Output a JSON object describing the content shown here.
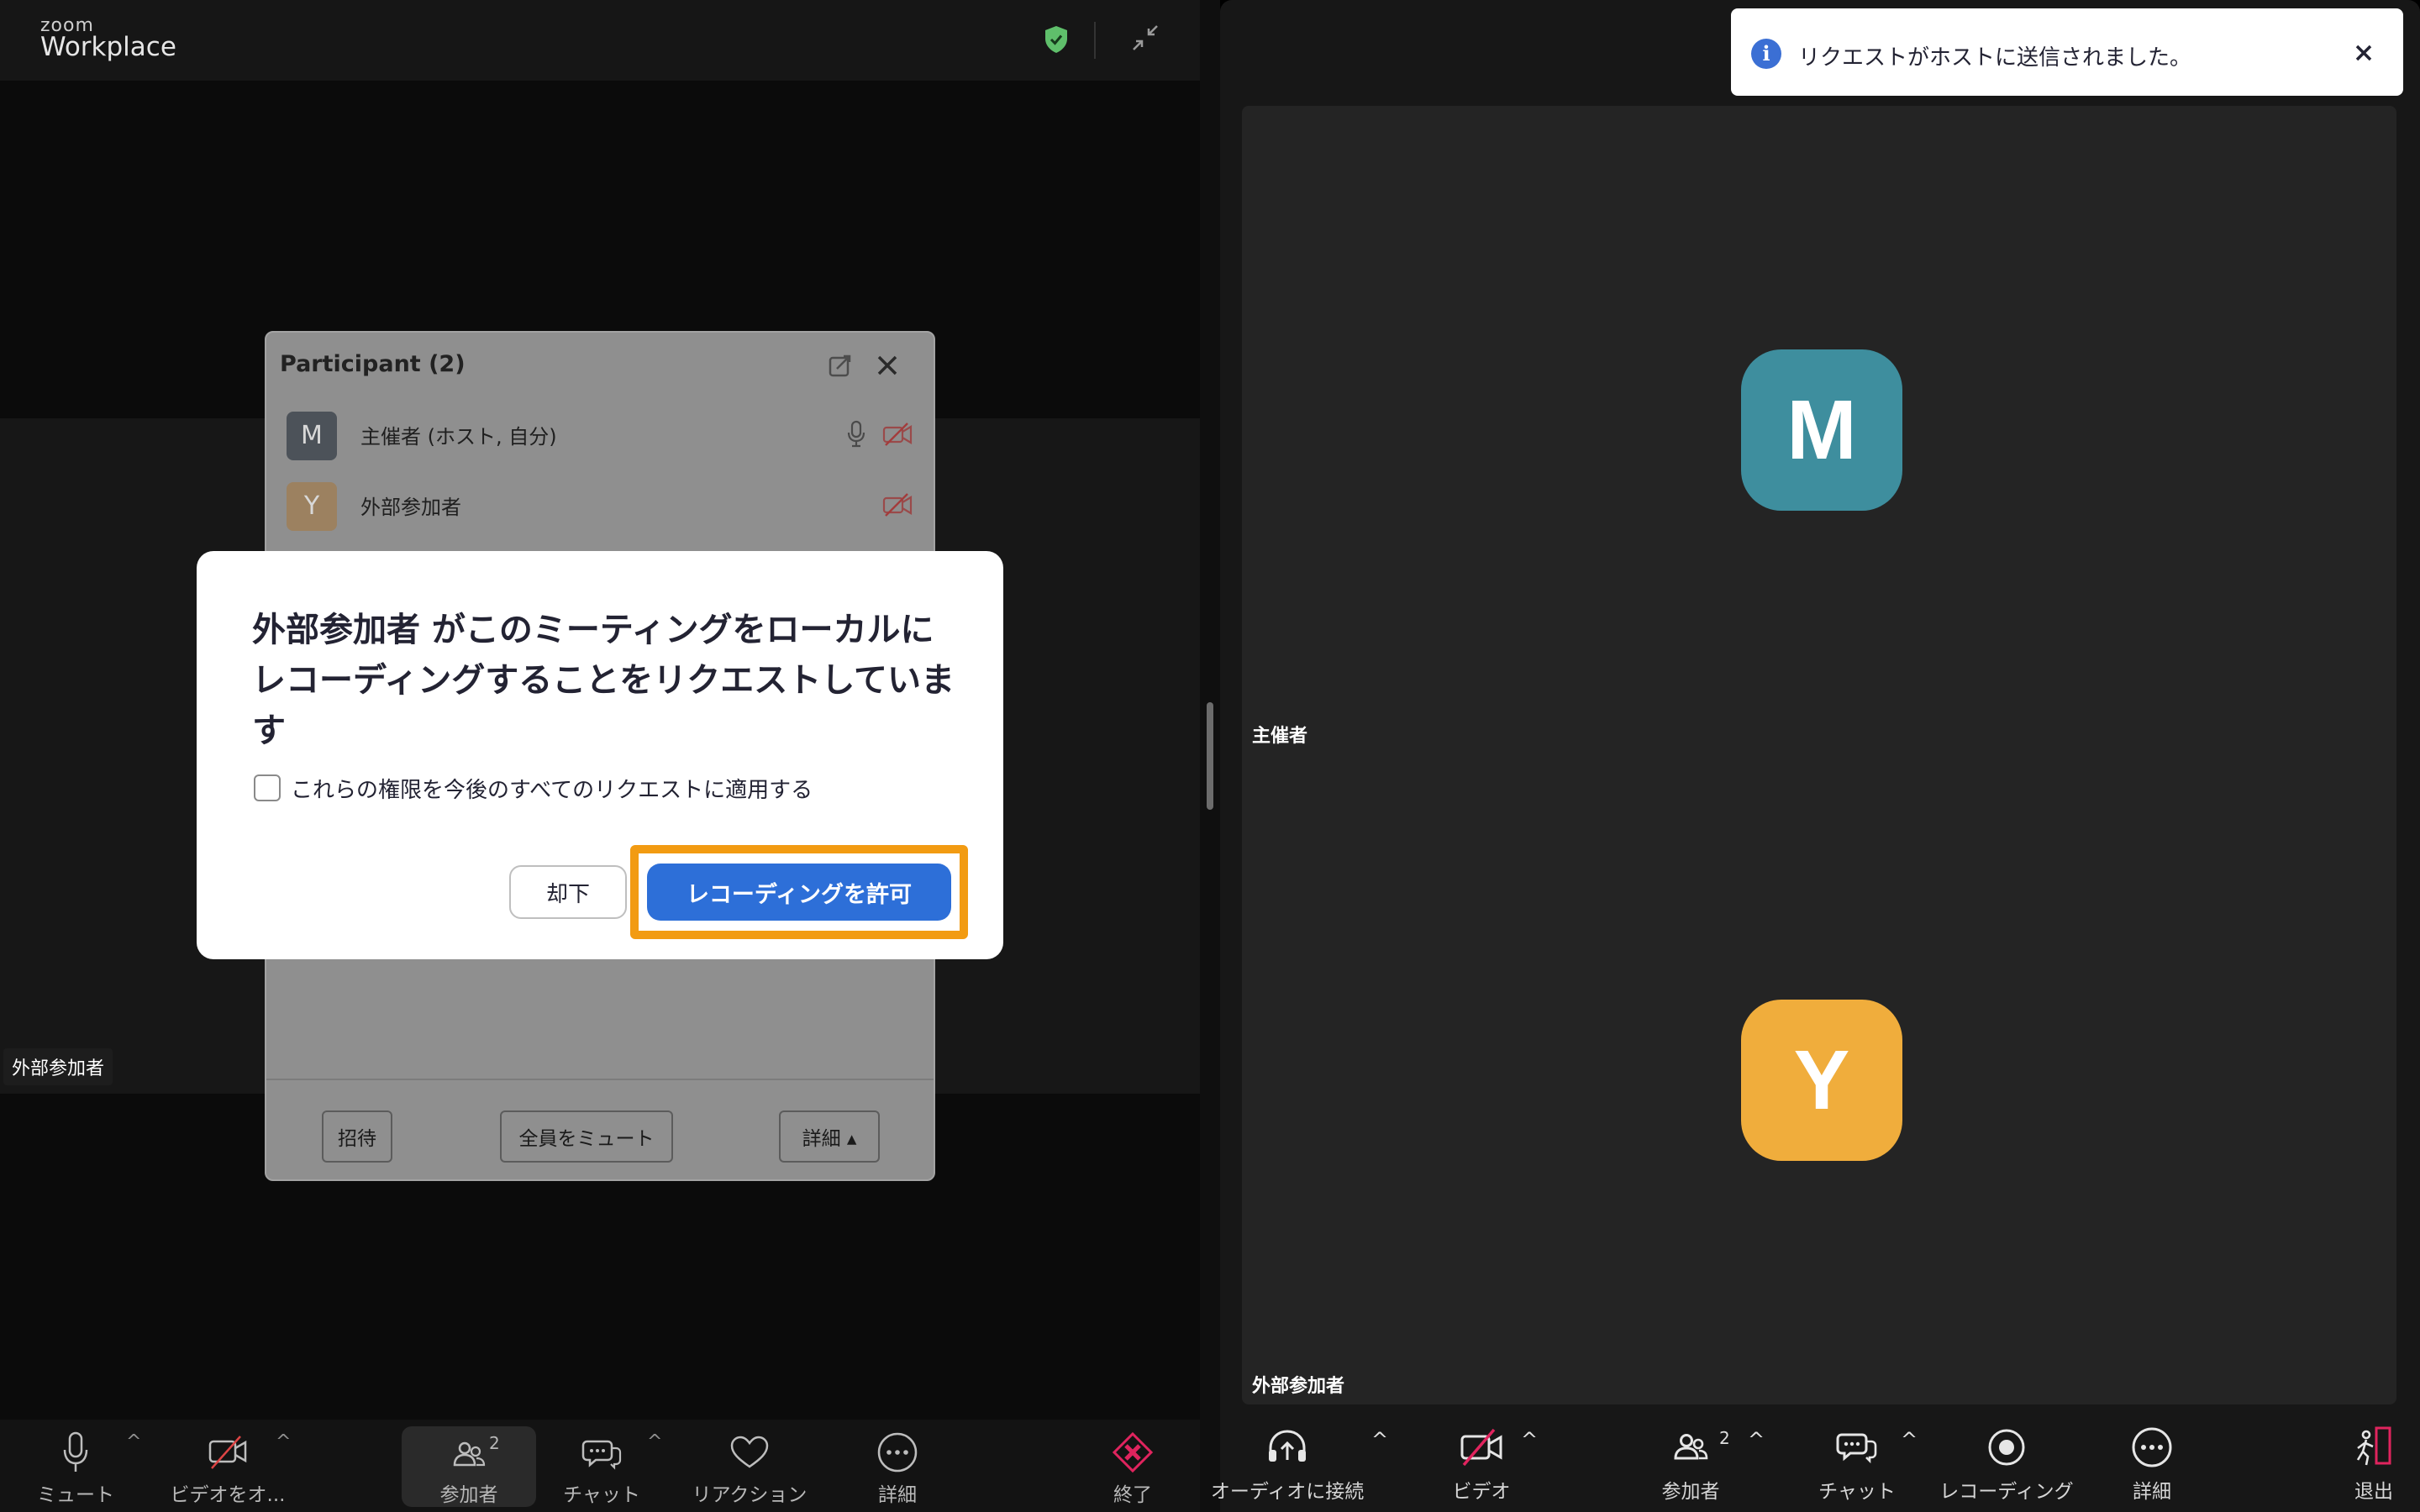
{
  "left": {
    "brand_small": "zoom",
    "brand_big": "Workplace",
    "name_tag": "外部参加者",
    "participants_panel": {
      "title": "Participant (2)",
      "rows": [
        {
          "initial": "M",
          "name": "主催者 (ホスト, 自分)"
        },
        {
          "initial": "Y",
          "name": "外部参加者"
        }
      ],
      "invite_label": "招待",
      "mute_all_label": "全員をミュート",
      "more_label": "詳細 ▴"
    },
    "modal": {
      "title": "外部参加者 がこのミーティングをローカルにレコーディングすることをリクエストしています",
      "checkbox_label": "これらの権限を今後のすべてのリクエストに適用する",
      "deny_label": "却下",
      "allow_label": "レコーディングを許可"
    },
    "toolbar": {
      "mute": "ミュート",
      "video": "ビデオをオ...",
      "participants": "参加者",
      "participants_count": "2",
      "chat": "チャット",
      "reaction": "リアクション",
      "more": "詳細",
      "end": "終了"
    }
  },
  "right": {
    "toast_text": "リクエストがホストに送信されました。",
    "host_initial": "M",
    "host_name": "主催者",
    "guest_initial": "Y",
    "guest_name": "外部参加者",
    "toolbar": {
      "audio": "オーディオに接続",
      "video": "ビデオ",
      "participants": "参加者",
      "participants_count": "2",
      "chat": "チャット",
      "record": "レコーディング",
      "more": "詳細",
      "leave": "退出"
    }
  },
  "colors": {
    "accent_blue": "#2d6fd8",
    "highlight_orange": "#f29b12",
    "host_avatar": "#3e8e9e",
    "guest_avatar": "#f0ad3c"
  }
}
